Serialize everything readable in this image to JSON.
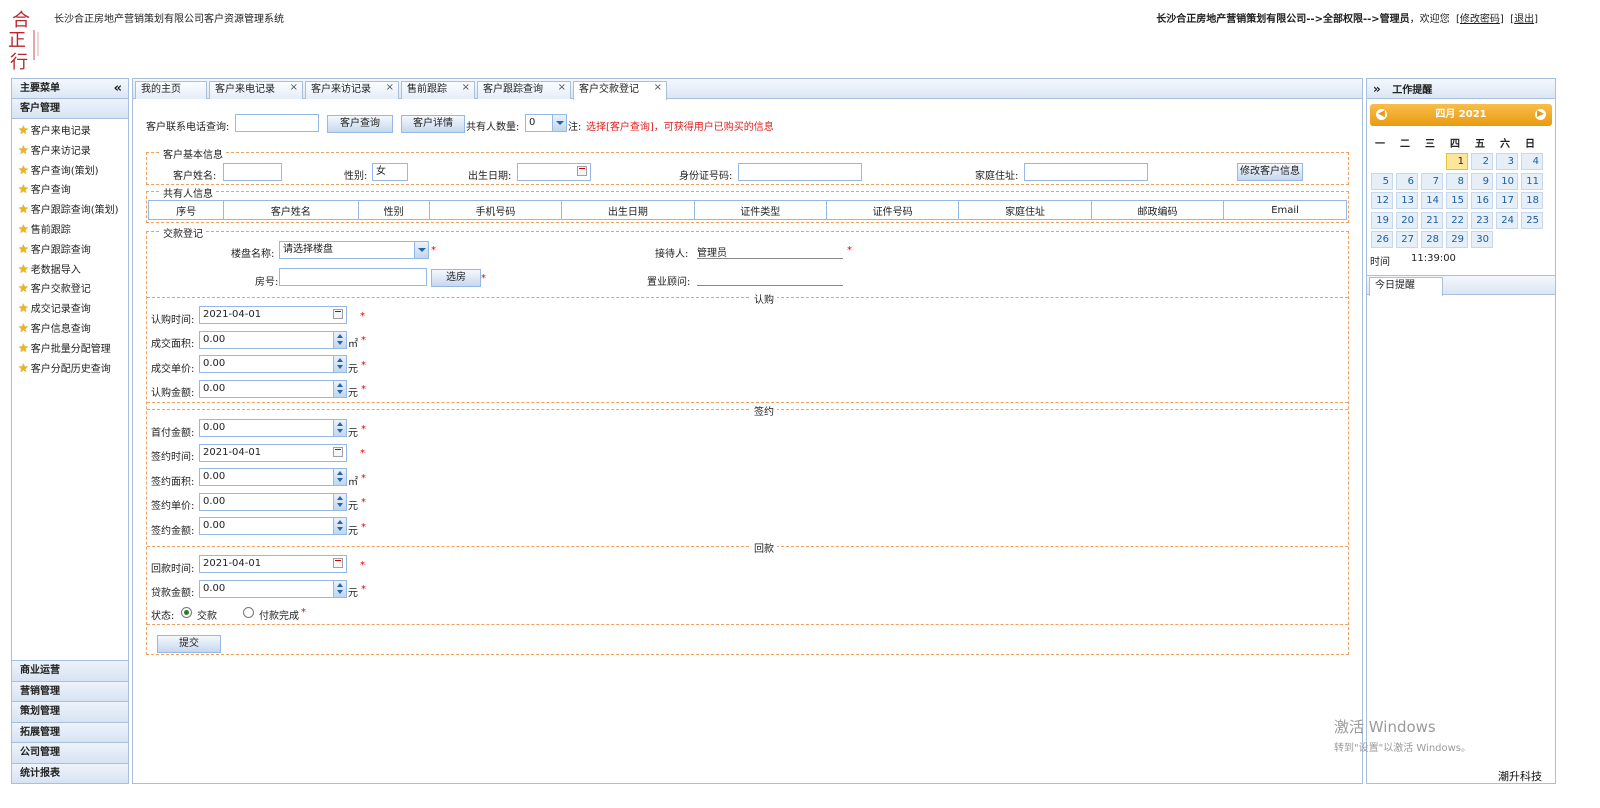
{
  "header": {
    "system_title": "长沙合正房地产营销策划有限公司客户资源管理系统",
    "company": "长沙合正房地产营销策划有限公司",
    "arrow1": "-->",
    "permission": "全部权限",
    "arrow2": "-->",
    "role": "管理员",
    "welcome": "，欢迎您",
    "change_password": "修改密码",
    "logout": "退出"
  },
  "left_menu": {
    "title": "主要菜单",
    "collapse": "«",
    "section": "客户管理",
    "items": [
      "客户来电记录",
      "客户来访记录",
      "客户查询(策划)",
      "客户查询",
      "客户跟踪查询(策划)",
      "售前跟踪",
      "客户跟踪查询",
      "老数据导入",
      "客户交款登记",
      "成交记录查询",
      "客户信息查询",
      "客户批量分配管理",
      "客户分配历史查询"
    ],
    "bottom_sections": [
      "商业运营",
      "营销管理",
      "策划管理",
      "拓展管理",
      "公司管理",
      "统计报表"
    ]
  },
  "tabs": [
    "我的主页",
    "客户来电记录",
    "客户来访记录",
    "售前跟踪",
    "客户跟踪查询",
    "客户交款登记"
  ],
  "tab_close": "×",
  "search": {
    "phone_label": "客户联系电话查询:",
    "query_btn": "客户查询",
    "detail_btn": "客户详情",
    "co_owner_count_label": "共有人数量:",
    "co_owner_count": "0",
    "note_label": "注:",
    "note": "选择[客户查询]，可获得用户已购买的信息"
  },
  "basic_info": {
    "legend": "客户基本信息",
    "name_label": "客户姓名:",
    "gender_label": "性别:",
    "gender": "女",
    "birth_label": "出生日期:",
    "id_label": "身份证号码:",
    "address_label": "家庭住址:",
    "modify_btn": "修改客户信息"
  },
  "co_owner": {
    "legend": "共有人信息",
    "columns": [
      "序号",
      "客户姓名",
      "性别",
      "手机号码",
      "出生日期",
      "证件类型",
      "证件号码",
      "家庭住址",
      "邮政编码",
      "Email"
    ]
  },
  "payment": {
    "legend": "交款登记",
    "building_label": "楼盘名称:",
    "building_value": "请选择楼盘",
    "receiver_label": "接待人:",
    "receiver": "管理员",
    "room_label": "房号:",
    "choose_room_btn": "选房",
    "consultant_label": "置业顾问:",
    "required": "*",
    "subscribe": {
      "title": "认购",
      "time_label": "认购时间:",
      "time": "2021-04-01",
      "area_label": "成交面积:",
      "area": "0.00",
      "area_unit": "㎡",
      "price_label": "成交单价:",
      "price": "0.00",
      "price_unit": "元",
      "amount_label": "认购金额:",
      "amount": "0.00",
      "amount_unit": "元"
    },
    "contract": {
      "title": "签约",
      "down_label": "首付金额:",
      "down": "0.00",
      "down_unit": "元",
      "time_label": "签约时间:",
      "time": "2021-04-01",
      "area_label": "签约面积:",
      "area": "0.00",
      "area_unit": "㎡",
      "price_label": "签约单价:",
      "price": "0.00",
      "price_unit": "元",
      "amount_label": "签约金额:",
      "amount": "0.00",
      "amount_unit": "元"
    },
    "refund": {
      "title": "回款",
      "time_label": "回款时间:",
      "time": "2021-04-01",
      "loan_label": "贷款金额:",
      "loan": "0.00",
      "loan_unit": "元",
      "status_label": "状态:",
      "status_opt1": "交款",
      "status_opt2": "付款完成"
    },
    "submit_btn": "提交"
  },
  "right_panel": {
    "expand": "»",
    "title": "工作提醒",
    "calendar_title": "四月 2021",
    "prev": "◀",
    "next": "▶",
    "weekdays": [
      "一",
      "二",
      "三",
      "四",
      "五",
      "六",
      "日"
    ],
    "days": [
      "1",
      "2",
      "3",
      "4",
      "5",
      "6",
      "7",
      "8",
      "9",
      "10",
      "11",
      "12",
      "13",
      "14",
      "15",
      "16",
      "17",
      "18",
      "19",
      "20",
      "21",
      "22",
      "23",
      "24",
      "25",
      "26",
      "27",
      "28",
      "29",
      "30"
    ],
    "time_label": "时间",
    "time": "11:39:00",
    "today_tab": "今日提醒"
  },
  "watermark": {
    "line1": "激活 Windows",
    "line2": "转到\"设置\"以激活 Windows。"
  },
  "brand": "潮升科技",
  "logo_text": "合正行"
}
